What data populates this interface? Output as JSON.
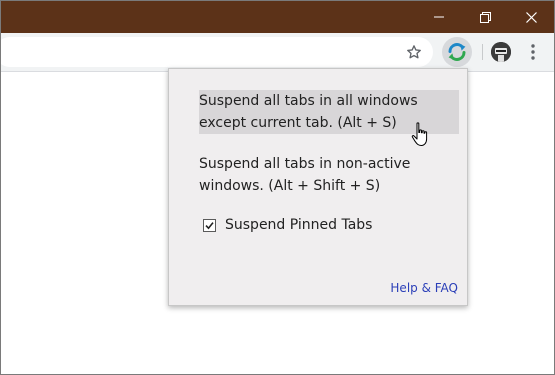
{
  "window": {
    "buttons": [
      "minimize",
      "restore",
      "close"
    ],
    "titlebar_color": "#5c3218"
  },
  "toolbar": {
    "bookmark_icon": "star-outline-icon",
    "extension_icon": "tab-suspender-refresh-icon",
    "menu_icon": "vertical-dots-icon"
  },
  "popup": {
    "items": [
      {
        "label": "Suspend all tabs in all windows except current tab. (Alt + S)",
        "hovered": true
      },
      {
        "label": "Suspend all tabs in non-active windows. (Alt + Shift + S)",
        "hovered": false
      }
    ],
    "checkbox": {
      "label": "Suspend Pinned Tabs",
      "checked": true
    },
    "help_link": "Help & FAQ",
    "link_color": "#2b3fb8"
  }
}
